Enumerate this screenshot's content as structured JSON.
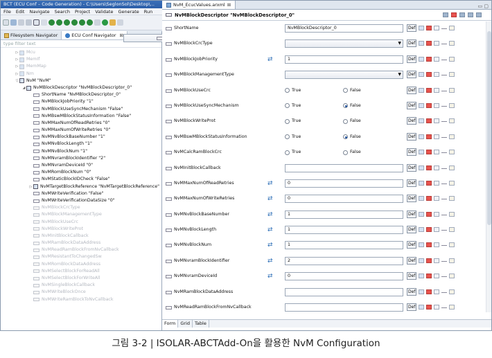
{
  "window": {
    "title": "BCT (ECU Conf – Code Generation) - C:\\Users\\SeglonSol\\Desktop\\..."
  },
  "menu": [
    "File",
    "Edit",
    "Navigate",
    "Search",
    "Project",
    "Validate",
    "Generate",
    "Run"
  ],
  "left": {
    "tabs": [
      {
        "label": "Filesystem Navigator"
      },
      {
        "label": "ECU Conf Navigator"
      }
    ],
    "filter_placeholder": "type filter text",
    "tree": [
      {
        "label": "Mcu",
        "level": 0,
        "twisty": "▷",
        "grey": true,
        "folder": true
      },
      {
        "label": "MemIf",
        "level": 0,
        "twisty": "▷",
        "grey": true,
        "folder": true
      },
      {
        "label": "MemMap",
        "level": 0,
        "twisty": "▷",
        "grey": true,
        "folder": true
      },
      {
        "label": "Nm",
        "level": 0,
        "twisty": "▷",
        "grey": true,
        "folder": true
      },
      {
        "label": "NvM \"NvM\"",
        "level": 0,
        "twisty": "▽",
        "folder": true
      },
      {
        "label": "NvMBlockDescriptor \"NvMBlockDescriptor_0\"",
        "level": 1,
        "twisty": "◢",
        "folder": true
      },
      {
        "label": "ShortName \"NvMBlockDescriptor_0\"",
        "level": 2
      },
      {
        "label": "NvMBlockJobPriority \"1\"",
        "level": 2
      },
      {
        "label": "NvMBlockUseSyncMechanism \"False\"",
        "level": 2
      },
      {
        "label": "NvMBswMBlockStatusInformation \"False\"",
        "level": 2
      },
      {
        "label": "NvMMaxNumOfReadRetries \"0\"",
        "level": 2
      },
      {
        "label": "NvMMaxNumOfWriteRetries \"0\"",
        "level": 2
      },
      {
        "label": "NvMNvBlockBaseNumber \"1\"",
        "level": 2
      },
      {
        "label": "NvMNvBlockLength \"1\"",
        "level": 2
      },
      {
        "label": "NvMNvBlockNum \"1\"",
        "level": 2
      },
      {
        "label": "NvMNvramBlockIdentifier \"2\"",
        "level": 2
      },
      {
        "label": "NvMNvramDeviceId \"0\"",
        "level": 2
      },
      {
        "label": "NvMRomBlockNum \"0\"",
        "level": 2
      },
      {
        "label": "NvMStaticBlockIDCheck \"False\"",
        "level": 2
      },
      {
        "label": "NvMTargetBlockReference \"NvMTargetBlockReference\"",
        "level": 2,
        "twisty": "▷",
        "folder": true
      },
      {
        "label": "NvMWriteVerification \"False\"",
        "level": 2
      },
      {
        "label": "NvMWriteVerificationDataSize \"0\"",
        "level": 2
      },
      {
        "label": "NvMBlockCrcType",
        "level": 2,
        "grey": true
      },
      {
        "label": "NvMBlockManagementType",
        "level": 2,
        "grey": true
      },
      {
        "label": "NvMBlockUseCrc",
        "level": 2,
        "grey": true
      },
      {
        "label": "NvMBlockWriteProt",
        "level": 2,
        "grey": true
      },
      {
        "label": "NvMCalcRamBlockCrc",
        "level": 2,
        "selected": true
      },
      {
        "label": "NvMInitBlockCallback",
        "level": 2,
        "grey": true
      },
      {
        "label": "NvMRamBlockDataAddress",
        "level": 2,
        "grey": true
      },
      {
        "label": "NvMReadRamBlockFromNvCallback",
        "level": 2,
        "grey": true
      },
      {
        "label": "NvMResistantToChangedSw",
        "level": 2,
        "grey": true
      },
      {
        "label": "NvMRomBlockDataAddress",
        "level": 2,
        "grey": true
      },
      {
        "label": "NvMSelectBlockForReadAll",
        "level": 2,
        "grey": true
      },
      {
        "label": "NvMSelectBlockForWriteAll",
        "level": 2,
        "grey": true
      },
      {
        "label": "NvMSingleBlockCallback",
        "level": 2,
        "grey": true
      },
      {
        "label": "NvMWriteBlockOnce",
        "level": 2,
        "grey": true
      },
      {
        "label": "NvMWriteRamBlockToNvCallback",
        "level": 2,
        "grey": true
      }
    ]
  },
  "editor": {
    "tab": "NvM_EcucValues.arxml",
    "header": "NvMBlockDescriptor \"NvMBlockDescriptor_0\"",
    "def_label": "Def",
    "true_label": "True",
    "false_label": "False",
    "rows": [
      {
        "label": "ShortName",
        "kind": "text",
        "value": "NvMBlockDescriptor_0"
      },
      {
        "label": "NvMBlockCrcType",
        "kind": "select",
        "value": ""
      },
      {
        "label": "NvMBlockJobPriority",
        "kind": "text",
        "value": "1",
        "swap": true
      },
      {
        "label": "NvMBlockManagementType",
        "kind": "select",
        "value": ""
      },
      {
        "label": "NvMBlockUseCrc",
        "kind": "radio",
        "checked": "none"
      },
      {
        "label": "NvMBlockUseSyncMechanism",
        "kind": "radio",
        "checked": "false"
      },
      {
        "label": "NvMBlockWriteProt",
        "kind": "radio",
        "checked": "none"
      },
      {
        "label": "NvMBswMBlockStatusInformation",
        "kind": "radio",
        "checked": "false"
      },
      {
        "label": "NvMCalcRamBlockCrc",
        "kind": "radio",
        "checked": "none"
      },
      {
        "label": "NvMInitBlockCallback",
        "kind": "text",
        "value": ""
      },
      {
        "label": "NvMMaxNumOfReadRetries",
        "kind": "text",
        "value": "0",
        "swap": true
      },
      {
        "label": "NvMMaxNumOfWriteRetries",
        "kind": "text",
        "value": "0",
        "swap": true
      },
      {
        "label": "NvMNvBlockBaseNumber",
        "kind": "text",
        "value": "1",
        "swap": true
      },
      {
        "label": "NvMNvBlockLength",
        "kind": "text",
        "value": "1",
        "swap": true
      },
      {
        "label": "NvMNvBlockNum",
        "kind": "text",
        "value": "1",
        "swap": true
      },
      {
        "label": "NvMNvramBlockIdentifier",
        "kind": "text",
        "value": "2",
        "swap": true
      },
      {
        "label": "NvMNvramDeviceId",
        "kind": "text",
        "value": "0",
        "swap": true
      },
      {
        "label": "NvMRamBlockDataAddress",
        "kind": "text",
        "value": ""
      },
      {
        "label": "NvMReadRamBlockFromNvCallback",
        "kind": "text",
        "value": ""
      }
    ],
    "bottom_tabs": [
      "Form",
      "Grid",
      "Table"
    ]
  },
  "caption": "그림 3-2 | ISOLAR-ABCTAdd-On을 활용한 NvM Configuration",
  "colors": {
    "titlebar": "#2b5ea8",
    "accent": "#2e6fb7",
    "default_marker": "#e8534e"
  }
}
